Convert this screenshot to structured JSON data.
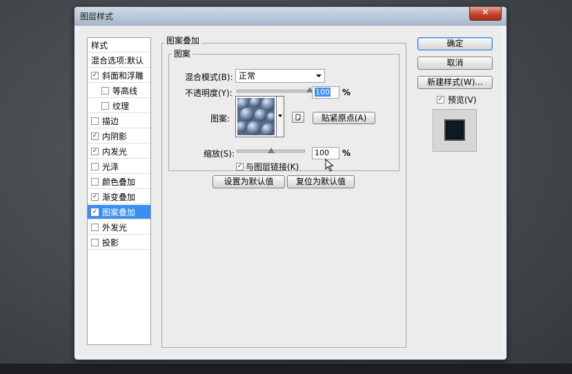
{
  "window": {
    "title": "图层样式",
    "close_glyph": "✕"
  },
  "style_list": {
    "header": "样式",
    "blend_options": "混合选项:默认",
    "items": [
      {
        "label": "斜面和浮雕",
        "checked": true,
        "indent": false,
        "selected": false
      },
      {
        "label": "等高线",
        "checked": false,
        "indent": true,
        "selected": false
      },
      {
        "label": "纹理",
        "checked": false,
        "indent": true,
        "selected": false
      },
      {
        "label": "描边",
        "checked": false,
        "indent": false,
        "selected": false
      },
      {
        "label": "内阴影",
        "checked": true,
        "indent": false,
        "selected": false
      },
      {
        "label": "内发光",
        "checked": true,
        "indent": false,
        "selected": false
      },
      {
        "label": "光泽",
        "checked": false,
        "indent": false,
        "selected": false
      },
      {
        "label": "颜色叠加",
        "checked": false,
        "indent": false,
        "selected": false
      },
      {
        "label": "渐变叠加",
        "checked": true,
        "indent": false,
        "selected": false
      },
      {
        "label": "图案叠加",
        "checked": true,
        "indent": false,
        "selected": true
      },
      {
        "label": "外发光",
        "checked": false,
        "indent": false,
        "selected": false
      },
      {
        "label": "投影",
        "checked": false,
        "indent": false,
        "selected": false
      }
    ]
  },
  "pattern_overlay": {
    "group_title": "图案叠加",
    "subgroup_title": "图案",
    "blend_mode_label": "混合模式(B):",
    "blend_mode_value": "正常",
    "opacity_label": "不透明度(Y):",
    "opacity_value": "100",
    "opacity_unit": "%",
    "opacity_level": 1.0,
    "pattern_label": "图案:",
    "snap_origin_button": "贴紧原点(A)",
    "scale_label": "缩放(S):",
    "scale_value": "100",
    "scale_unit": "%",
    "scale_level": 0.5,
    "link_label": "与图层链接(K)",
    "link_checked": true,
    "make_default_button": "设置为默认值",
    "reset_default_button": "复位为默认值"
  },
  "right_panel": {
    "ok_button": "确定",
    "cancel_button": "取消",
    "new_style_button": "新建样式(W)...",
    "preview_label": "预览(V)",
    "preview_checked": true
  },
  "colors": {
    "selection": "#3b8ff3",
    "close_button": "#c4432c",
    "title_bar": "#b9c8d8",
    "pattern_tone": "#7f95b3"
  },
  "check_glyph": "✓"
}
